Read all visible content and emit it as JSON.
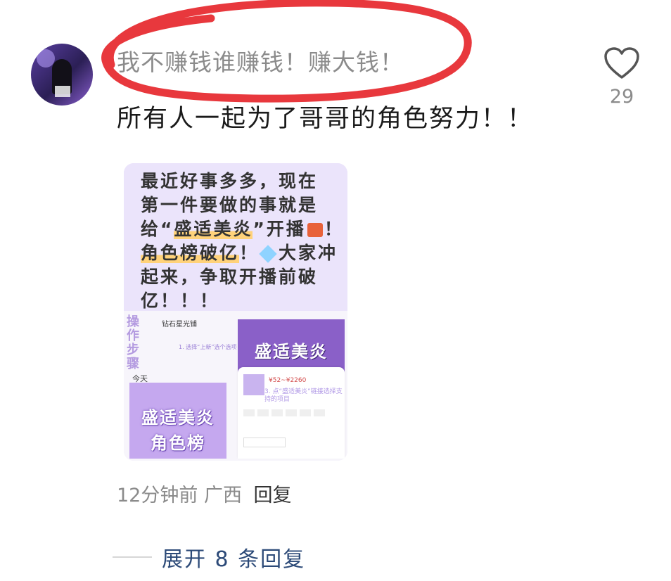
{
  "comment": {
    "username": "我不赚钱谁赚钱！赚大钱！",
    "text": "所有人一起为了哥哥的角色努力！！",
    "time": "12分钟前",
    "location": "广西",
    "reply_label": "回复",
    "like_count": "29",
    "expand_label": "展开 8 条回复",
    "highlight_color": "#e8383d"
  },
  "attachment": {
    "lines": [
      "最近好事多多，现在",
      "第一件要做的事就是",
      "给“",
      "盛适美炎",
      "”开播",
      "！",
      "角色榜破亿",
      "！",
      "大家冲",
      "起来，争取开播前破",
      "亿！！！"
    ],
    "screenshot": {
      "steps_label": "操作步骤",
      "shop_name": "钻石星光铺",
      "step_hint_1": "1. 选择“上新”选个选项",
      "step_hint_3": "3. 点“盛适美炎”链接选择支持的项目",
      "today_label": "今天",
      "card_title": "盛适美炎",
      "card_subtitle": "角色榜",
      "price": "¥52~¥2260"
    }
  }
}
